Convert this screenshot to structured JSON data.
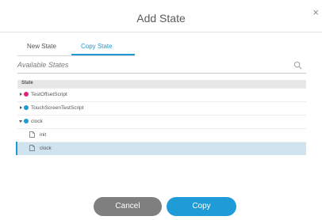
{
  "dialog": {
    "title": "Add State",
    "close_glyph": "×"
  },
  "tabs": [
    {
      "label": "New State",
      "active": false
    },
    {
      "label": "Copy State",
      "active": true
    }
  ],
  "search": {
    "placeholder": "Available States",
    "icon": "search-icon"
  },
  "tree": {
    "header": "State",
    "rows": [
      {
        "label": "TestOffsetScript",
        "expanded": false,
        "dot_color": "#e0227a"
      },
      {
        "label": "TouchScreenTestScript",
        "expanded": false,
        "dot_color": "#1e9ad6"
      },
      {
        "label": "clock",
        "expanded": true,
        "dot_color": "#1e9ad6"
      },
      {
        "label": "init",
        "icon": "file-icon"
      },
      {
        "label": "clock",
        "icon": "file-icon",
        "selected": true
      }
    ]
  },
  "buttons": {
    "cancel": "Cancel",
    "copy": "Copy"
  },
  "colors": {
    "accent": "#1e9ad6",
    "cancel": "#7f7f7f",
    "selected_row": "#cfe4ef"
  }
}
